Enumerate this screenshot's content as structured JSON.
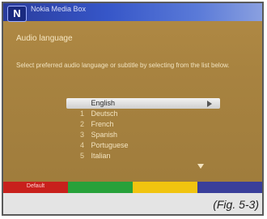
{
  "window": {
    "logo_text": "N",
    "title": "Nokia Media Box"
  },
  "menu": {
    "heading": "Audio language",
    "description": "Select preferred audio language or subtitle by selecting from the list below.",
    "items": [
      {
        "num": "",
        "label": "English"
      },
      {
        "num": "1",
        "label": "Deutsch"
      },
      {
        "num": "2",
        "label": "French"
      },
      {
        "num": "3",
        "label": "Spanish"
      },
      {
        "num": "4",
        "label": "Portuguese"
      },
      {
        "num": "5",
        "label": "Italian"
      }
    ]
  },
  "colorbar": {
    "red_label": "Default",
    "red": "#c8201c",
    "green": "#27a13a",
    "yellow": "#f1c40f",
    "blue": "#3a3f9a"
  },
  "caption": "(Fig. 5-3)"
}
